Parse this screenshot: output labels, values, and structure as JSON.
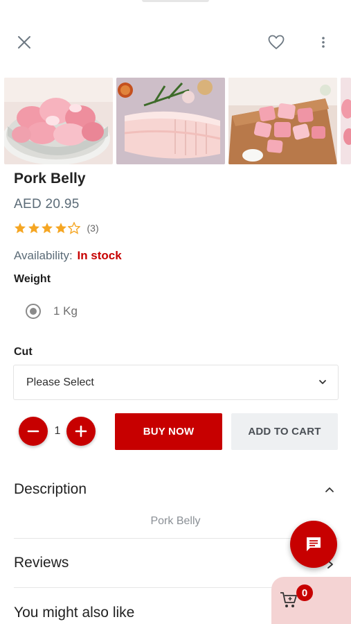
{
  "product": {
    "title": "Pork Belly",
    "price": "AED 20.95",
    "rating_stars": 4,
    "rating_max": 5,
    "rating_count": "(3)",
    "availability_label": "Availability:",
    "availability_value": "In stock",
    "images": [
      "pork-cubes-bowl-image",
      "pork-belly-slab-image",
      "pork-cubes-board-image",
      "pork-partial-image"
    ]
  },
  "options": {
    "weight_label": "Weight",
    "weight_value": "1 Kg",
    "cut_label": "Cut",
    "cut_placeholder": "Please Select"
  },
  "cart_actions": {
    "quantity": "1",
    "buy_now": "BUY NOW",
    "add_to_cart": "ADD TO CART"
  },
  "sections": {
    "description_title": "Description",
    "description_text": "Pork Belly",
    "reviews_title": "Reviews",
    "also_like_title": "You might also like"
  },
  "cart": {
    "count": "0"
  },
  "icons": {
    "close": "close-icon",
    "favorite": "heart-icon",
    "more": "more-vertical-icon",
    "chat": "chat-icon",
    "cart": "cart-icon"
  },
  "colors": {
    "accent": "#c70000",
    "star": "#f5a623",
    "secondary_button_bg": "#eef0f2",
    "cart_panel_bg": "#f4d3d3"
  }
}
